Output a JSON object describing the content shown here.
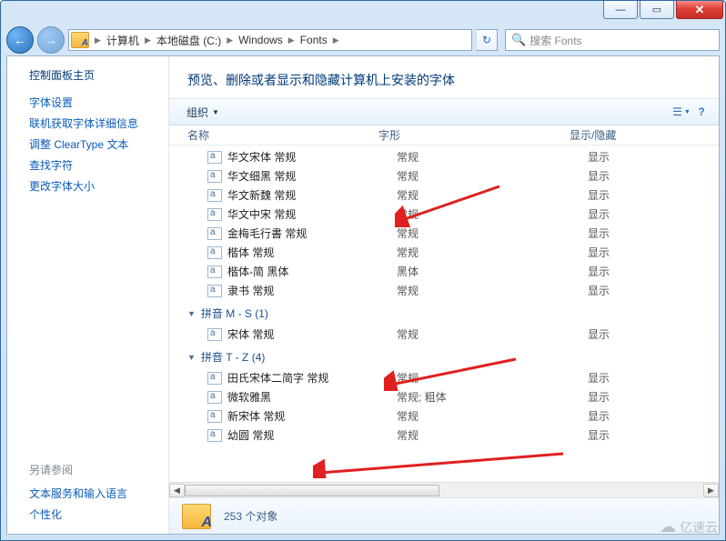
{
  "window_controls": {
    "minimize": "—",
    "maximize": "▭",
    "close": "✕"
  },
  "nav": {
    "back": "←",
    "forward": "→"
  },
  "breadcrumbs": [
    "计算机",
    "本地磁盘 (C:)",
    "Windows",
    "Fonts"
  ],
  "search": {
    "placeholder": "搜索 Fonts"
  },
  "sidebar": {
    "header": "控制面板主页",
    "links": [
      "字体设置",
      "联机获取字体详细信息",
      "调整 ClearType 文本",
      "查找字符",
      "更改字体大小"
    ],
    "see_also_header": "另请参阅",
    "see_also": [
      "文本服务和输入语言",
      "个性化"
    ]
  },
  "page_title": "预览、删除或者显示和隐藏计算机上安装的字体",
  "toolbar": {
    "organize": "组织"
  },
  "columns": {
    "name": "名称",
    "style": "字形",
    "showhide": "显示/隐藏"
  },
  "items": [
    {
      "name": "华文宋体 常规",
      "style": "常规",
      "showhide": "显示"
    },
    {
      "name": "华文细黑 常规",
      "style": "常规",
      "showhide": "显示"
    },
    {
      "name": "华文新魏 常规",
      "style": "常规",
      "showhide": "显示"
    },
    {
      "name": "华文中宋 常规",
      "style": "常规",
      "showhide": "显示"
    },
    {
      "name": "金梅毛行書 常规",
      "style": "常规",
      "showhide": "显示"
    },
    {
      "name": "楷体 常规",
      "style": "常规",
      "showhide": "显示"
    },
    {
      "name": "楷体-简 黑体",
      "style": "黑体",
      "showhide": "显示"
    },
    {
      "name": "隶书 常规",
      "style": "常规",
      "showhide": "显示"
    }
  ],
  "group_ms": {
    "label": "拼音 M - S (1)"
  },
  "items_ms": [
    {
      "name": "宋体 常规",
      "style": "常规",
      "showhide": "显示"
    }
  ],
  "group_tz": {
    "label": "拼音 T - Z (4)"
  },
  "items_tz": [
    {
      "name": "田氏宋体二简字 常规",
      "style": "常规",
      "showhide": "显示"
    },
    {
      "name": "微软雅黑",
      "style": "常规; 粗体",
      "showhide": "显示"
    },
    {
      "name": "新宋体 常规",
      "style": "常规",
      "showhide": "显示"
    },
    {
      "name": "幼圆 常规",
      "style": "常规",
      "showhide": "显示"
    }
  ],
  "status": {
    "count_text": "253 个对象"
  },
  "watermark": "亿速云"
}
